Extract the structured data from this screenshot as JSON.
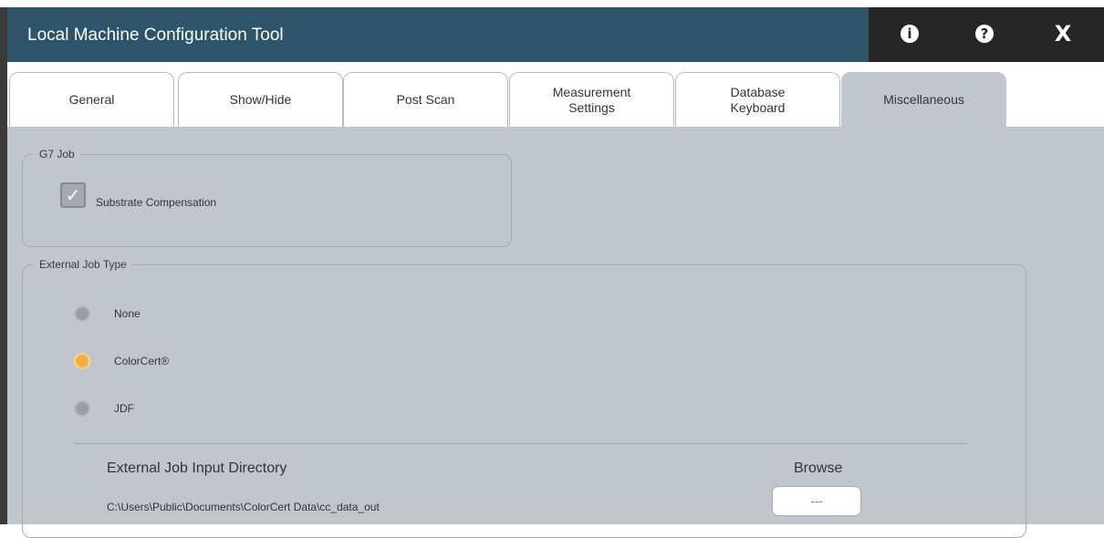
{
  "app": {
    "title": "Local Machine Configuration Tool"
  },
  "window_controls": {
    "info_icon": "i",
    "help_icon": "?",
    "close_icon": "X"
  },
  "tabs": [
    {
      "label": "General",
      "active": false
    },
    {
      "label": "Show/Hide",
      "active": false
    },
    {
      "label": "Post Scan",
      "active": false
    },
    {
      "label": "Measurement\nSettings",
      "active": false
    },
    {
      "label": "Database\nKeyboard",
      "active": false
    },
    {
      "label": "Miscellaneous",
      "active": true
    }
  ],
  "g7_job": {
    "legend": "G7 Job",
    "substrate_compensation": {
      "label": "Substrate Compensation",
      "checked": true
    }
  },
  "external_job_type": {
    "legend": "External Job Type",
    "options": [
      {
        "label": "None",
        "selected": false
      },
      {
        "label": "ColorCert®",
        "selected": true
      },
      {
        "label": "JDF",
        "selected": false
      }
    ],
    "input_directory_label": "External Job Input Directory",
    "input_directory_path": "C:\\Users\\Public\\Documents\\ColorCert Data\\cc_data_out",
    "browse_label": "Browse",
    "browse_button": "---"
  },
  "colors": {
    "titlebar": "#2d5468",
    "controls_bg": "#262626",
    "content_bg": "#c1c6cc",
    "radio_selected": "#f6ae3f",
    "radio_unselected": "#9a9ea2"
  }
}
